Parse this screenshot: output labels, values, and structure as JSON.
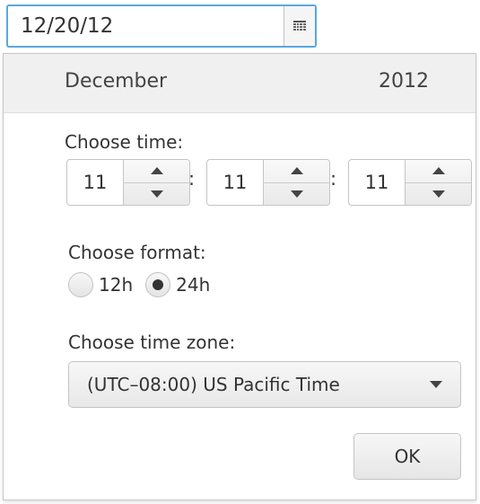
{
  "date_field": {
    "value": "12/20/12"
  },
  "calendar_button": {
    "icon": "calendar-icon"
  },
  "header": {
    "month": "December",
    "year": "2012"
  },
  "time": {
    "label": "Choose time:",
    "separator": ":",
    "hours": "11",
    "minutes": "11",
    "seconds": "11"
  },
  "format": {
    "label": "Choose format:",
    "options": [
      {
        "label": "12h",
        "selected": false
      },
      {
        "label": "24h",
        "selected": true
      }
    ]
  },
  "timezone": {
    "label": "Choose time zone:",
    "selected": "(UTC–08:00) US Pacific Time"
  },
  "ok_button": {
    "label": "OK"
  },
  "colors": {
    "focus_border": "#5ba7e0",
    "header_bg": "#f0f0f0"
  }
}
